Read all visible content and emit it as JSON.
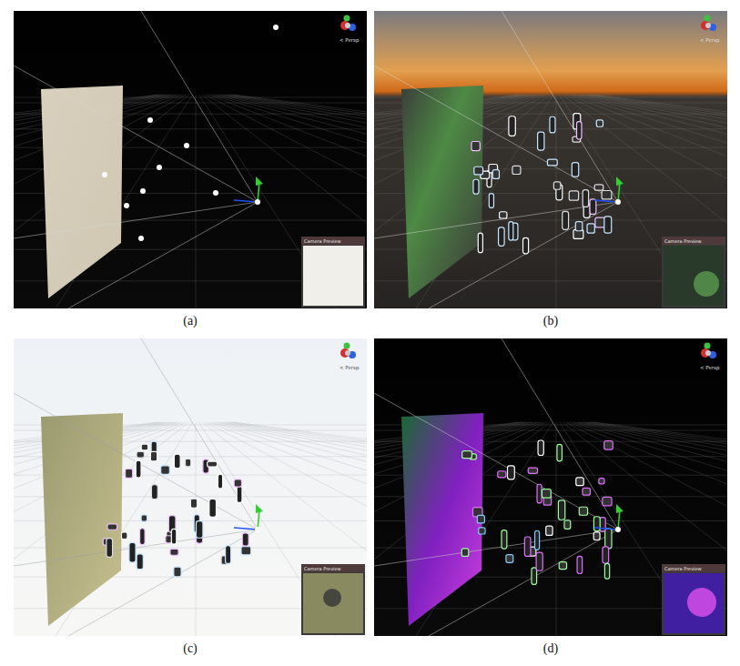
{
  "figure": {
    "panels": [
      {
        "caption": "(a)",
        "kind": "empty",
        "gizmo_label": "< Persp",
        "preview_title": "Camera Preview"
      },
      {
        "caption": "(b)",
        "kind": "sunset",
        "gizmo_label": "< Persp",
        "preview_title": "Camera Preview"
      },
      {
        "caption": "(c)",
        "kind": "light",
        "gizmo_label": "< Persp",
        "preview_title": "Camera Preview"
      },
      {
        "caption": "(d)",
        "kind": "neon",
        "gizmo_label": "< Persp",
        "preview_title": "Camera Preview"
      }
    ]
  }
}
